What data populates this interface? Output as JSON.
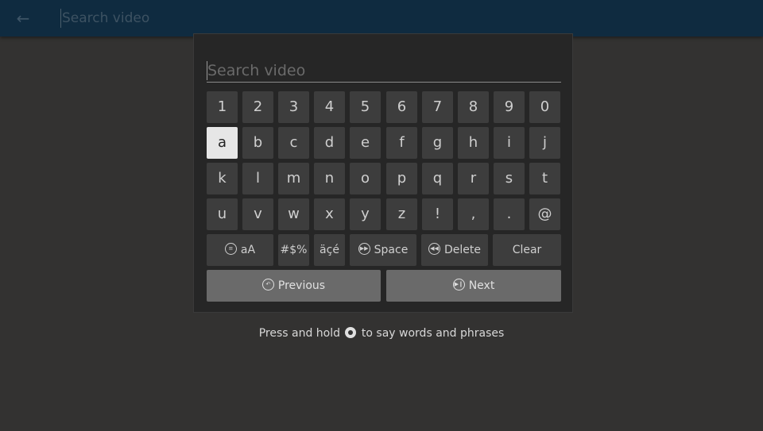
{
  "topbar": {
    "back_icon": "arrow-left-icon",
    "search_placeholder": "Search video"
  },
  "keyboard": {
    "search_placeholder": "Search video",
    "selected_key": "a",
    "rows": [
      [
        "1",
        "2",
        "3",
        "4",
        "5",
        "6",
        "7",
        "8",
        "9",
        "0"
      ],
      [
        "a",
        "b",
        "c",
        "d",
        "e",
        "f",
        "g",
        "h",
        "i",
        "j"
      ],
      [
        "k",
        "l",
        "m",
        "n",
        "o",
        "p",
        "q",
        "r",
        "s",
        "t"
      ],
      [
        "u",
        "v",
        "w",
        "x",
        "y",
        "z",
        "!",
        ",",
        ".",
        "@"
      ]
    ],
    "function_keys": {
      "case_toggle": "aA",
      "symbols": "#$%",
      "accents": "äçé",
      "space": "Space",
      "delete": "Delete",
      "clear": "Clear"
    },
    "previous_label": "Previous",
    "next_label": "Next"
  },
  "hint": {
    "before": "Press and hold",
    "after": "to say words and phrases"
  }
}
